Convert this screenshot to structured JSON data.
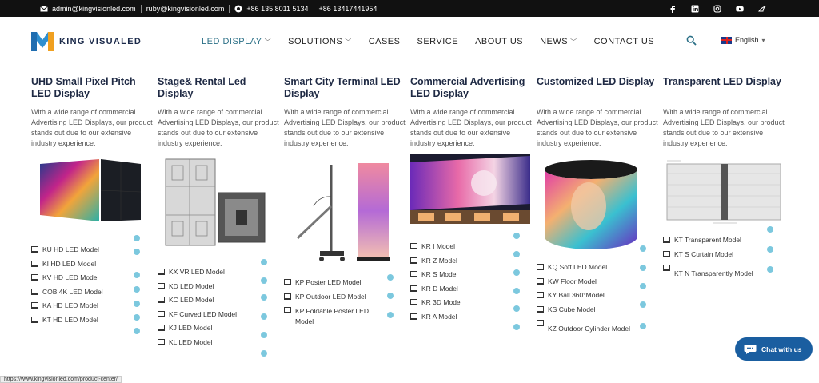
{
  "topbar": {
    "email1": "admin@kingvisionled.com",
    "email2": "ruby@kingvisionled.com",
    "phone1": "+86 135 8011 5134",
    "phone2": "+86 13417441954",
    "social_icons": [
      "facebook-icon",
      "linkedin-icon",
      "instagram-icon",
      "youtube-icon",
      "tiktok-icon"
    ]
  },
  "logo": {
    "text": "KING VISUALED"
  },
  "nav": {
    "items": [
      {
        "label": "LED DISPLAY",
        "dropdown": true
      },
      {
        "label": "SOLUTIONS",
        "dropdown": true
      },
      {
        "label": "CASES",
        "dropdown": false
      },
      {
        "label": "SERVICE",
        "dropdown": false
      },
      {
        "label": "ABOUT US",
        "dropdown": false
      },
      {
        "label": "NEWS",
        "dropdown": true
      },
      {
        "label": "CONTACT US",
        "dropdown": false
      }
    ],
    "language": "English"
  },
  "columns": [
    {
      "title": "UHD Small Pixel Pitch LED Display",
      "desc": "With a wide range of commercial Advertising LED Displays, our product stands out due to our extensive industry experience.",
      "models": [
        "KU HD LED Model",
        "KI HD LED Model",
        "KV HD LED Model",
        "COB 4K LED Model",
        "KA HD LED Model",
        "KT HD LED Model"
      ]
    },
    {
      "title": "Stage& Rental Led Display",
      "desc": "With a wide range of commercial Advertising LED Displays, our product stands out due to our extensive industry experience.",
      "models": [
        "KX VR LED Model",
        "KD LED Model",
        "KC LED Model",
        "KF Curved LED Model",
        "KJ LED Model",
        "KL LED Model"
      ]
    },
    {
      "title": "Smart City Terminal LED Display",
      "desc": "With a wide range of commercial Advertising LED Displays, our product stands out due to our extensive industry experience.",
      "models": [
        "KP Poster LED Model",
        "KP Outdoor LED Model",
        "KP Foldable Poster LED Model"
      ]
    },
    {
      "title": "Commercial Advertising LED Display",
      "desc": "With a wide range of commercial Advertising LED Displays, our product stands out due to our extensive industry experience.",
      "models": [
        "KR I Model",
        "KR Z Model",
        "KR S Model",
        "KR D Model",
        "KR 3D Model",
        "KR A Model"
      ]
    },
    {
      "title": "Customized LED Display",
      "desc": "With a wide range of commercial Advertising LED Displays, our product stands out due to our extensive industry experience.",
      "models": [
        "KQ Soft LED Model",
        "KW Floor Model",
        "KY Ball 360°Model",
        "KS Cube Model",
        "KZ Outdoor Cylinder Model"
      ]
    },
    {
      "title": "Transparent LED Display",
      "desc": "With a wide range of commercial Advertising LED Displays, our product stands out due to our extensive industry experience.",
      "models": [
        "KT Transparent Model",
        "KT S Curtain Model",
        "KT N Transparently Model"
      ]
    }
  ],
  "chat": {
    "label": "Chat with us"
  },
  "status_url": "https://www.kingvisionled.com/product-center/",
  "colors": {
    "accent": "#2a6f86",
    "chat": "#1a5ea0",
    "topbar": "#111111",
    "arrow": "#4ab3d0"
  }
}
